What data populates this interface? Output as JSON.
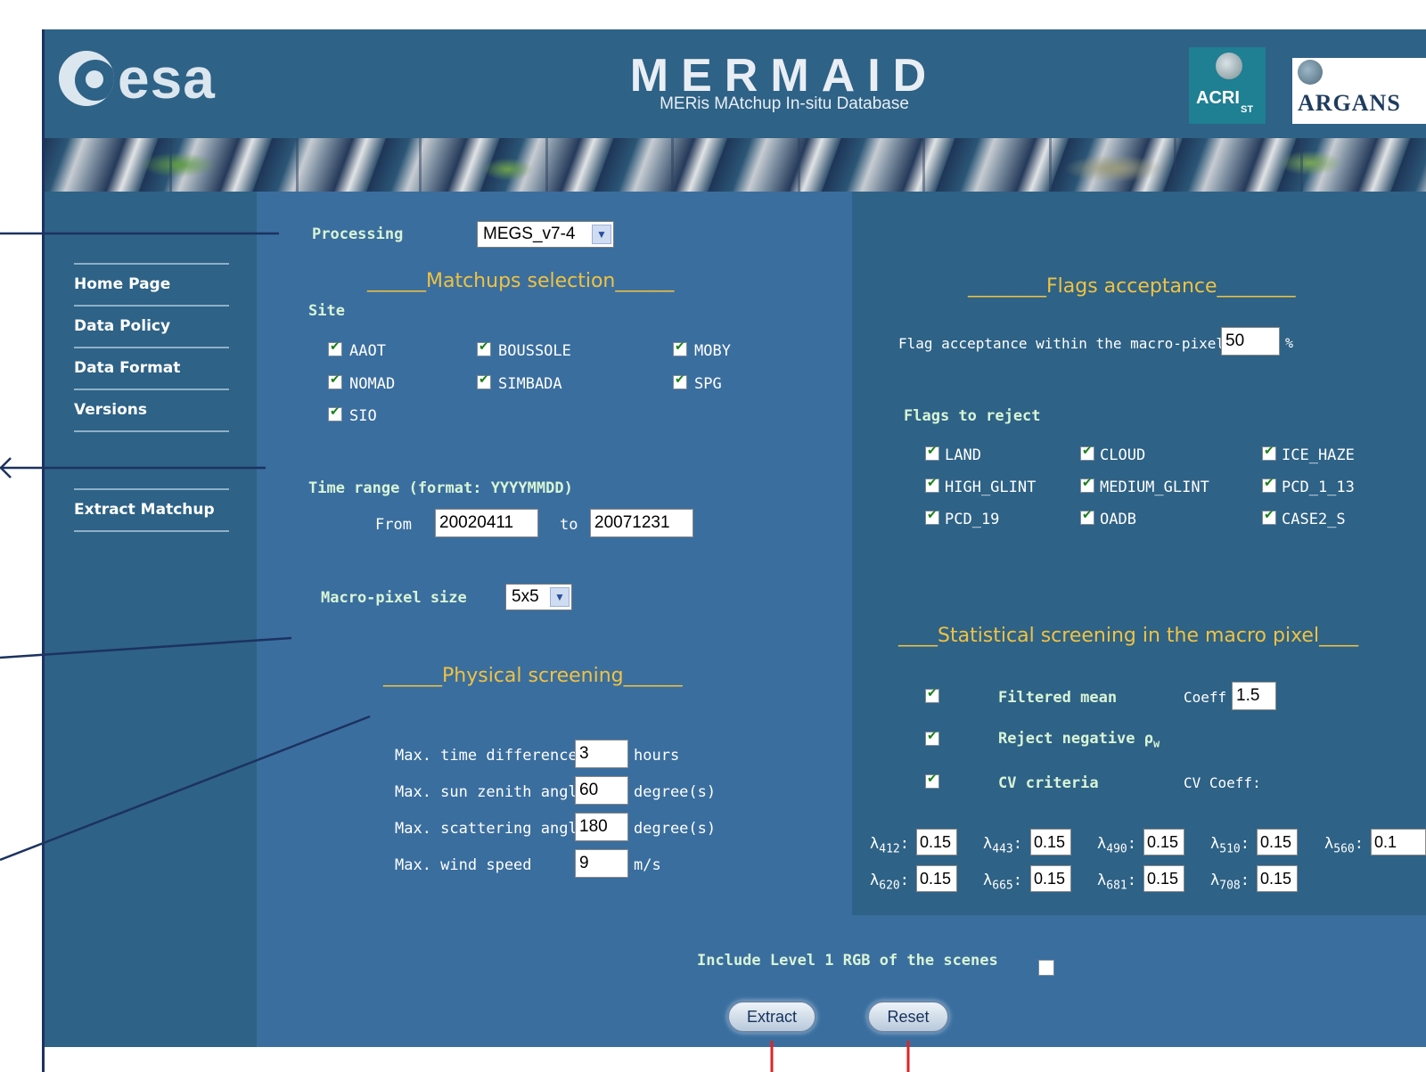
{
  "header": {
    "esa_logo": "esa",
    "app_title": "MERMAID",
    "app_subtitle": "MERis MAtchup In-situ Database",
    "partner1": "ACRI",
    "partner1_sub": "ST",
    "partner2": "ARGANS"
  },
  "sidebar": {
    "items": [
      {
        "label": "Home Page"
      },
      {
        "label": "Data Policy"
      },
      {
        "label": "Data Format"
      },
      {
        "label": "Versions"
      },
      {
        "label": "Extract Matchup"
      }
    ]
  },
  "processing": {
    "label": "Processing",
    "value": "MEGS_v7-4"
  },
  "matchups": {
    "title": "______Matchups selection______",
    "site_label": "Site",
    "sites": [
      {
        "label": "AAOT",
        "checked": true
      },
      {
        "label": "BOUSSOLE",
        "checked": true
      },
      {
        "label": "MOBY",
        "checked": true
      },
      {
        "label": "NOMAD",
        "checked": true
      },
      {
        "label": "SIMBADA",
        "checked": true
      },
      {
        "label": "SPG",
        "checked": true
      },
      {
        "label": "SIO",
        "checked": true
      }
    ]
  },
  "time_range": {
    "label": "Time range (format: YYYYMMDD)",
    "from_label": "From",
    "from_value": "20020411",
    "to_label": "to",
    "to_value": "20071231"
  },
  "macro_pixel": {
    "label": "Macro-pixel size",
    "value": "5x5"
  },
  "physical": {
    "title": "______Physical screening______",
    "rows": [
      {
        "label": "Max. time difference",
        "value": "3",
        "unit": "hours"
      },
      {
        "label": "Max. sun zenith angle",
        "value": "60",
        "unit": "degree(s)"
      },
      {
        "label": "Max. scattering angle",
        "value": "180",
        "unit": "degree(s)"
      },
      {
        "label": "Max. wind speed",
        "value": "9",
        "unit": "m/s"
      }
    ]
  },
  "flags": {
    "title": "________Flags acceptance________",
    "acceptance_label": "Flag acceptance within the macro-pixel",
    "acceptance_value": "50",
    "acceptance_unit": "%",
    "reject_label": "Flags to reject",
    "items": [
      {
        "label": "LAND",
        "checked": true
      },
      {
        "label": "CLOUD",
        "checked": true
      },
      {
        "label": "ICE_HAZE",
        "checked": true
      },
      {
        "label": "HIGH_GLINT",
        "checked": true
      },
      {
        "label": "MEDIUM_GLINT",
        "checked": true
      },
      {
        "label": "PCD_1_13",
        "checked": true
      },
      {
        "label": "PCD_19",
        "checked": true
      },
      {
        "label": "OADB",
        "checked": true
      },
      {
        "label": "CASE2_S",
        "checked": true
      }
    ]
  },
  "statistical": {
    "title": "____Statistical screening in the macro pixel____",
    "filtered_mean": {
      "label": "Filtered mean",
      "coeff_label": "Coeff",
      "coeff_value": "1.5",
      "checked": true
    },
    "reject_negative": {
      "label": "Reject negative ρ",
      "sub": "w",
      "checked": true
    },
    "cv_criteria": {
      "label": "CV criteria",
      "coeff_label": "CV Coeff:",
      "checked": true
    },
    "lambdas": [
      {
        "sym": "λ",
        "band": "412",
        "value": "0.15"
      },
      {
        "sym": "λ",
        "band": "443",
        "value": "0.15"
      },
      {
        "sym": "λ",
        "band": "490",
        "value": "0.15"
      },
      {
        "sym": "λ",
        "band": "510",
        "value": "0.15"
      },
      {
        "sym": "λ",
        "band": "560",
        "value": "0.1"
      },
      {
        "sym": "λ",
        "band": "620",
        "value": "0.15"
      },
      {
        "sym": "λ",
        "band": "665",
        "value": "0.15"
      },
      {
        "sym": "λ",
        "band": "681",
        "value": "0.15"
      },
      {
        "sym": "λ",
        "band": "708",
        "value": "0.15"
      }
    ]
  },
  "footer": {
    "include_rgb_label": "Include Level 1 RGB of the scenes",
    "include_rgb_checked": false,
    "extract_label": "Extract",
    "reset_label": "Reset"
  },
  "colors": {
    "header_bg": "#2e6286",
    "main_bg": "#3a6e9e",
    "accent_yellow": "#f0c242",
    "annotation_line": "#1c3260",
    "annotation_red": "#e0232a"
  }
}
